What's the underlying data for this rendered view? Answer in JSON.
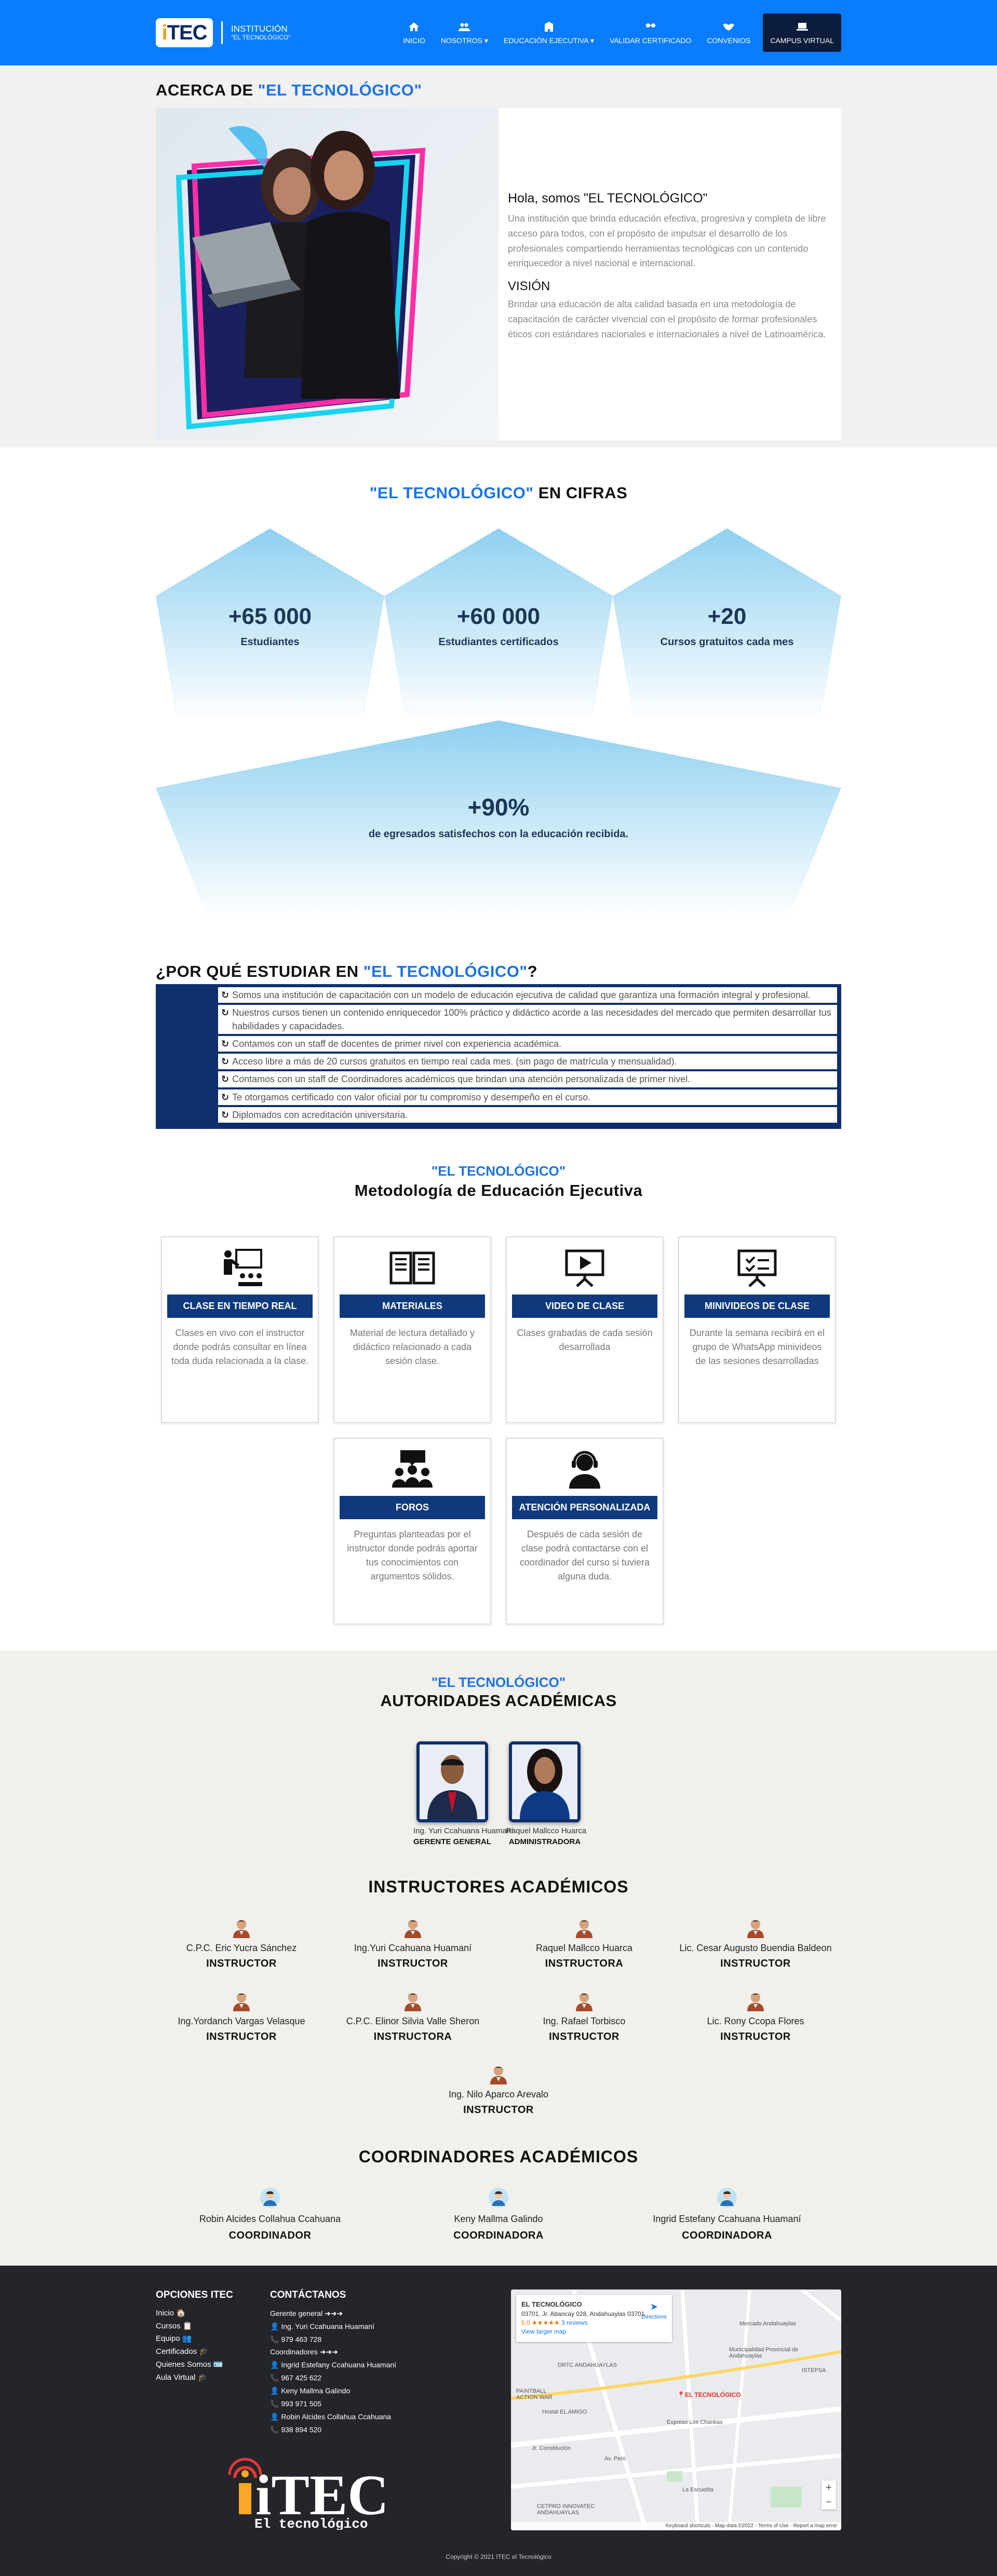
{
  "navbar": {
    "logo": "iTEC",
    "brand_line1": "INSTITUCIÓN",
    "brand_line2": "\"EL TECNOLÓGICO\"",
    "items": [
      {
        "label": "INICIO"
      },
      {
        "label": "NOSOTROS ▾"
      },
      {
        "label": "EDUCACIÓN EJECUTIVA ▾"
      },
      {
        "label": "VALIDAR CERTIFICADO"
      },
      {
        "label": "CONVENIOS"
      },
      {
        "label": "CAMPUS VIRTUAL"
      }
    ]
  },
  "about": {
    "title_prefix": "ACERCA DE ",
    "title_highlight": "\"EL TECNOLÓGICO\"",
    "heading": "Hola, somos \"EL TECNOLÓGICO\"",
    "paragraph": "Una institución que brinda educación efectiva, progresiva y completa de libre acceso para todos, con el propósito de impulsar el desarrollo de los profesionales compartiendo herramientas tecnológicas con un contenido enriquecedor a nivel nacional e internacional.",
    "vision_title": "VISIÓN",
    "vision_text": "Brindar una educación de alta calidad basada en una metodología de capacitación de carácter vivencial con el propósito de formar profesionales éticos con estándares nacionales e internacionales a nivel de Latinoamérica."
  },
  "cifras": {
    "title_highlight": "\"EL TECNOLÓGICO\"",
    "title_suffix": " EN CIFRAS",
    "stats": [
      {
        "value": "+65 000",
        "label": "Estudiantes"
      },
      {
        "value": "+60 000",
        "label": "Estudiantes certificados"
      },
      {
        "value": "+20",
        "label": "Cursos gratuitos cada mes"
      }
    ],
    "big": {
      "value": "+90%",
      "label": "de egresados satisfechos con la educación recibida."
    }
  },
  "why": {
    "title_prefix": "¿POR QUÉ ESTUDIAR EN ",
    "title_highlight": "\"EL TECNOLÓGICO\"",
    "title_suffix": "?",
    "items": [
      "Somos una institución de capacitación con un modelo de educación ejecutiva de calidad que garantiza una formación integral y profesional.",
      "Nuestros cursos tienen un contenido enriquecedor 100% práctico y didáctico acorde a las necesidades del mercado que permiten desarrollar tus habilidades y capacidades.",
      "Contamos con un staff de docentes de primer nivel con experiencia académica.",
      "Acceso libre a más de 20 cursos gratuitos en tiempo real cada mes. (sin pago de matrícula y mensualidad).",
      "Contamos con un staff de Coordinadores académicos que brindan una atención personalizada de primer nivel.",
      "Te otorgamos certificado con valor oficial por tu compromiso y desempeño en el curso.",
      "Diplomados con acreditación universitaria."
    ]
  },
  "metodologia": {
    "subtitle": "\"EL TECNOLÓGICO\"",
    "title": "Metodología de Educación Ejecutiva",
    "cards": [
      {
        "icon": "teacher-icon",
        "tag": "CLASE EN TIEMPO REAL",
        "text": "Clases en vivo con el instructor donde podrás consultar en línea toda duda relacionada a la clase."
      },
      {
        "icon": "book-icon",
        "tag": "MATERIALES",
        "text": "Material de lectura detallado y didáctico relacionado a cada sesión clase."
      },
      {
        "icon": "video-board-icon",
        "tag": "VIDEO DE CLASE",
        "text": "Clases grabadas de cada sesión desarrollada"
      },
      {
        "icon": "checklist-board-icon",
        "tag": "MINIVIDEOS DE CLASE",
        "text": "Durante la semana recibirá en el grupo de WhatsApp minivideos de las sesiones desarrolladas"
      },
      {
        "icon": "forum-icon",
        "tag": "FOROS",
        "text": "Preguntas planteadas por el instructor donde podrás aportar tus conocimientos con argumentos sólidos."
      },
      {
        "icon": "support-agent-icon",
        "tag": "ATENCIÓN PERSONALIZADA",
        "text": "Después de cada sesión de clase podrá contactarse con el coordinador del curso si tuviera alguna duda."
      }
    ]
  },
  "autoridades": {
    "subtitle": "\"EL TECNOLÓGICO\"",
    "title": "AUTORIDADES ACADÉMICAS",
    "people": [
      {
        "name": "Ing. Yuri Ccahuana Huamaní",
        "role": "GERENTE GENERAL"
      },
      {
        "name": "Raquel Mallcco Huarca",
        "role": "ADMINISTRADORA"
      }
    ],
    "instructores_title": "INSTRUCTORES ACADÉMICOS",
    "instructores": [
      {
        "name": "C.P.C. Eric Yucra Sánchez",
        "role": "INSTRUCTOR"
      },
      {
        "name": "Ing.Yuri Ccahuana Huamaní",
        "role": "INSTRUCTOR"
      },
      {
        "name": "Raquel Mallcco Huarca",
        "role": "INSTRUCTORA"
      },
      {
        "name": "Lic. Cesar Augusto Buendia Baldeon",
        "role": "INSTRUCTOR"
      },
      {
        "name": "Ing.Yordanch Vargas Velasque",
        "role": "INSTRUCTOR"
      },
      {
        "name": "C.P.C. Elinor Silvia Valle Sheron",
        "role": "INSTRUCTORA"
      },
      {
        "name": "Ing. Rafael Torbisco",
        "role": "INSTRUCTOR"
      },
      {
        "name": "Lic. Rony Ccopa Flores",
        "role": "INSTRUCTOR"
      },
      {
        "name": "Ing. Nilo Aparco Arevalo",
        "role": "INSTRUCTOR"
      }
    ],
    "coordinadores_title": "COORDINADORES ACADÉMICOS",
    "coordinadores": [
      {
        "name": "Robin Alcides Collahua Ccahuana",
        "role": "COORDINADOR"
      },
      {
        "name": "Keny Mallma Galindo",
        "role": "COORDINADORA"
      },
      {
        "name": "Ingrid Estefany Ccahuana Huamaní",
        "role": "COORDINADORA"
      }
    ]
  },
  "footer": {
    "col1_title": "OPCIONES ITEC",
    "links": [
      "Inicio 🏠",
      "Cursos 📋",
      "Equipo 👥",
      "Certificados 🎓",
      "Quienes Somos 🪪",
      "Aula Virtual 🎓"
    ],
    "col2_title": "CONTÁCTANOS",
    "lines": [
      "Gerente general ➜➜➜",
      "👤 Ing. Yuri Ccahuana Huamaní",
      "📞 979 463 728",
      "Coordinadores ➜➜➜",
      "👤 Ingrid Estefany Ccahuana Huamaní",
      "📞 967 425 622",
      "👤 Keny Mallma Galindo",
      "📞 993 971 505",
      "👤 Robin Alcides Collahua Ccahuana",
      "📞 938 894 520"
    ],
    "map": {
      "place": "EL TECNOLÓGICO",
      "address": "03701, Jr. Abancay 028, Andahuaylas 03701",
      "rating": "5.0 ★★★★★",
      "reviews": "3 reviews",
      "view_larger": "View larger map",
      "directions": "Directions",
      "labels": [
        "Mercado Andahuaylas",
        "Municipalidad Provincial de Andahuaylas",
        "DRTC ANDAHUAYLAS",
        "ISTEPSA",
        "PAINTBALL ACTION WAR",
        "Hostal EL AMIGO",
        "Expreso Los Chankas",
        "EL TECNOLÓGICO",
        "Jr. Constitución",
        "Av. Perú",
        "CETPRO INNOVATEC ANDAHUAYLAS",
        "La Escuelita"
      ],
      "attribution": "Keyboard shortcuts · Map data ©2022 · Terms of Use · Report a map error"
    },
    "logo_text": "iTEC",
    "logo_sub": "El tecnológico",
    "copyright": "Copyright © 2021 ITEC el Tecnológico"
  }
}
